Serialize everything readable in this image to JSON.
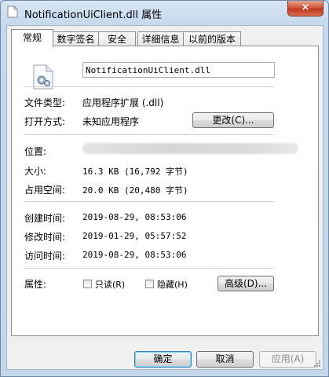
{
  "window": {
    "title": "NotificationUiClient.dll 属性",
    "close_label": "×"
  },
  "tabs": [
    {
      "label": "常规",
      "active": true
    },
    {
      "label": "数字签名",
      "active": false
    },
    {
      "label": "安全",
      "active": false
    },
    {
      "label": "详细信息",
      "active": false
    },
    {
      "label": "以前的版本",
      "active": false
    }
  ],
  "general": {
    "filename": "NotificationUiClient.dll",
    "file_type_label": "文件类型:",
    "file_type_value": "应用程序扩展 (.dll)",
    "open_with_label": "打开方式:",
    "open_with_value": "未知应用程序",
    "change_button": "更改(C)...",
    "location_label": "位置:",
    "size_label": "大小:",
    "size_value": "16.3 KB (16,792 字节)",
    "size_on_disk_label": "占用空间:",
    "size_on_disk_value": "20.0 KB (20,480 字节)",
    "created_label": "创建时间:",
    "created_value": "2019-08-29, 08:53:06",
    "modified_label": "修改时间:",
    "modified_value": "2019-01-29, 05:57:52",
    "accessed_label": "访问时间:",
    "accessed_value": "2019-08-29, 08:53:06",
    "attributes_label": "属性:",
    "readonly_label": "只读(R)",
    "hidden_label": "隐藏(H)",
    "advanced_button": "高级(D)..."
  },
  "footer": {
    "ok": "确定",
    "cancel": "取消",
    "apply": "应用(A)"
  }
}
